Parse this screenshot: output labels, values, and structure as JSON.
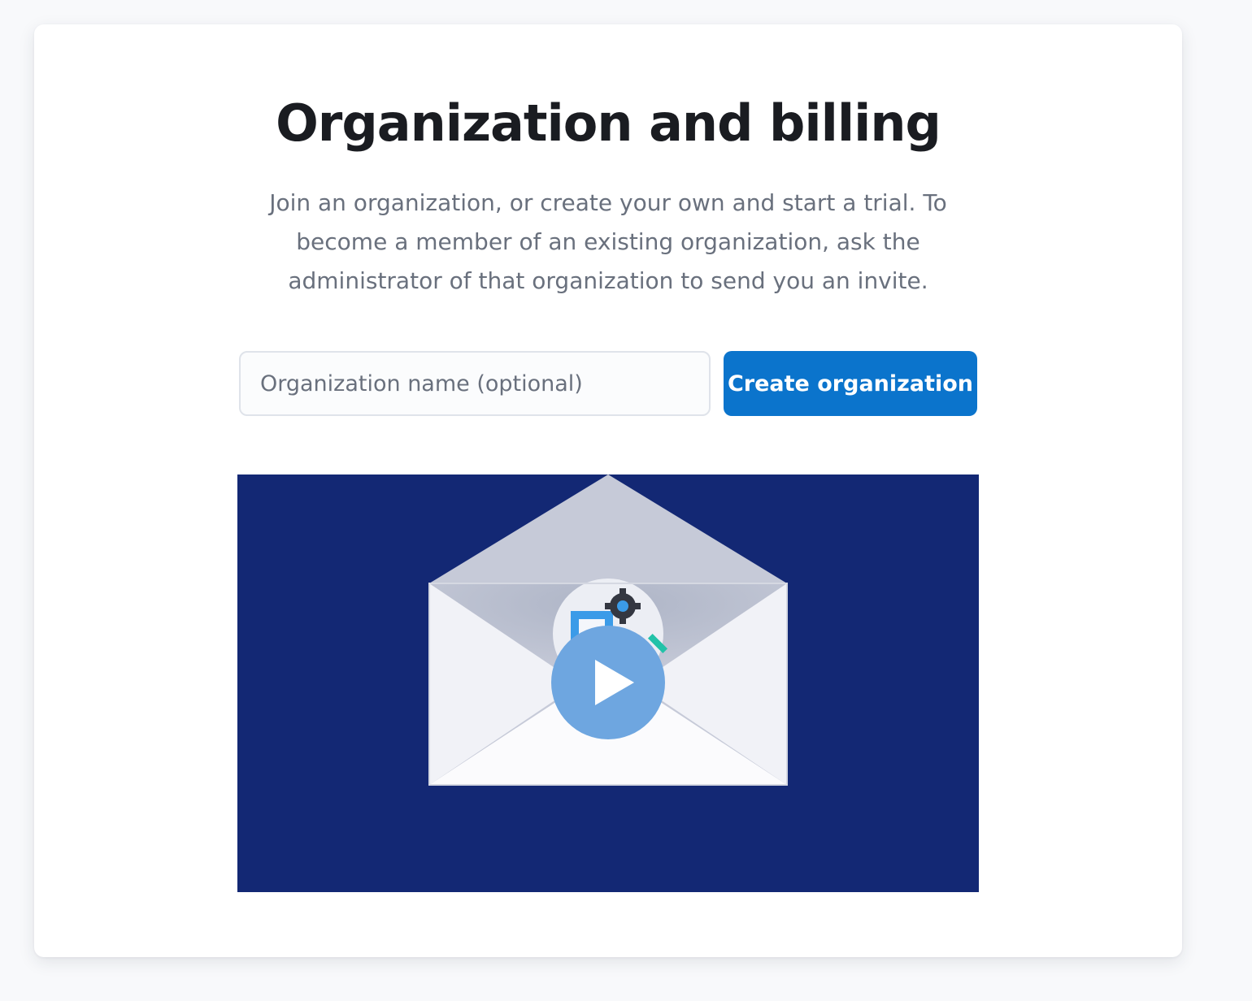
{
  "page": {
    "title": "Organization and billing",
    "description": "Join an organization, or create your own and start a trial. To become a member of an existing organization, ask the administrator of that organization to send you an invite."
  },
  "form": {
    "org_name_placeholder": "Organization name (optional)",
    "org_name_value": "",
    "create_button_label": "Create organization"
  },
  "video": {
    "thumbnail_icon": "envelope-illustration",
    "play_icon": "play-icon"
  },
  "colors": {
    "primary_button": "#0b74cc",
    "video_background": "#132874",
    "heading_text": "#1a1c21",
    "body_text": "#69707d"
  }
}
